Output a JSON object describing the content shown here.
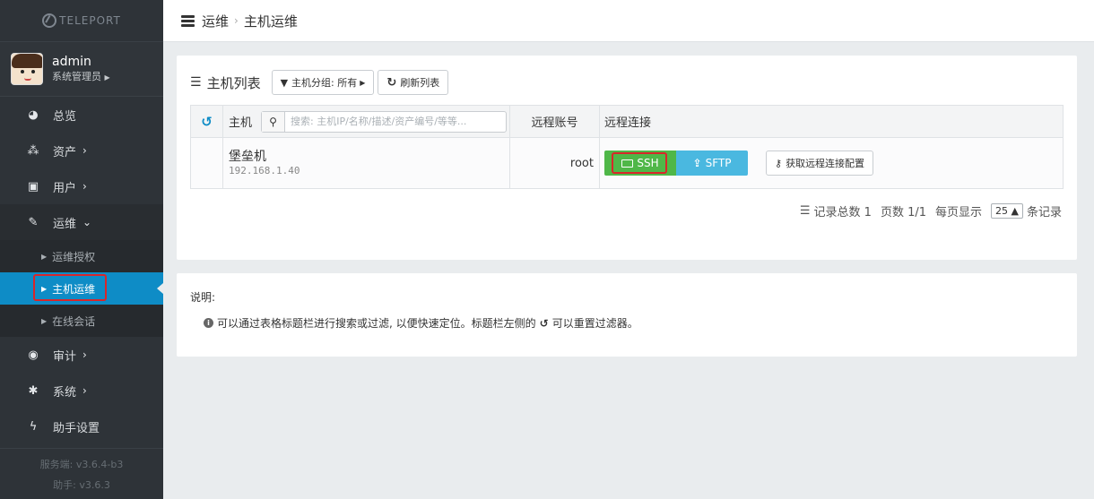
{
  "brand": {
    "name": "TELEPORT"
  },
  "user": {
    "name": "admin",
    "role": "系统管理员"
  },
  "nav": {
    "items": [
      {
        "label": "总览",
        "icon": "dashboard-icon"
      },
      {
        "label": "资产",
        "icon": "cubes-icon"
      },
      {
        "label": "用户",
        "icon": "user-card-icon"
      },
      {
        "label": "运维",
        "icon": "wrench-icon"
      },
      {
        "label": "审计",
        "icon": "eye-icon"
      },
      {
        "label": "系统",
        "icon": "gear-icon"
      },
      {
        "label": "助手设置",
        "icon": "bolt-icon"
      }
    ],
    "sub": [
      {
        "label": "运维授权"
      },
      {
        "label": "主机运维"
      },
      {
        "label": "在线会话"
      }
    ]
  },
  "version": {
    "server": "服务端: v3.6.4-b3",
    "assist": "助手: v3.6.3"
  },
  "breadcrumb": {
    "section": "运维",
    "page": "主机运维"
  },
  "list": {
    "title": "主机列表",
    "group_btn": "主机分组: 所有",
    "refresh_btn": "刷新列表"
  },
  "table": {
    "headers": {
      "host": "主机",
      "account": "远程账号",
      "conn": "远程连接"
    },
    "search_placeholder": "搜索: 主机IP/名称/描述/资产编号/等等...",
    "rows": [
      {
        "name": "堡垒机",
        "ip": "192.168.1.40",
        "account": "root"
      }
    ],
    "ssh": "SSH",
    "sftp": "SFTP",
    "config_btn": "获取远程连接配置"
  },
  "pager": {
    "total": "记录总数 1",
    "pages": "页数 1/1",
    "per_page_label": "每页显示",
    "per_page": "25 ▲",
    "suffix": "条记录"
  },
  "note": {
    "title": "说明:",
    "text_a": "可以通过表格标题栏进行搜索或过滤, 以便快速定位。标题栏左侧的",
    "text_b": "可以重置过滤器。"
  },
  "colors": {
    "sidebar": "#2e3338",
    "active": "#0e8cc6",
    "ssh": "#4fb748",
    "sftp": "#4ab8e0",
    "highlight": "#d9262a"
  }
}
